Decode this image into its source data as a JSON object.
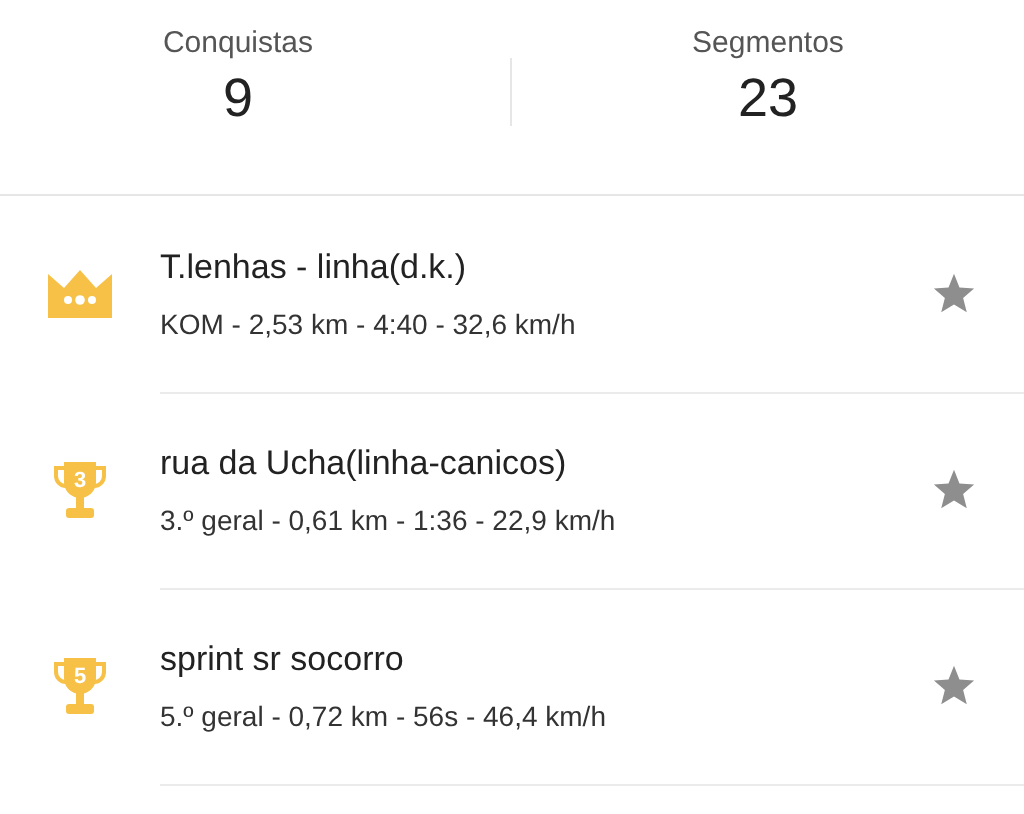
{
  "stats": [
    {
      "label": "Conquistas",
      "value": "9"
    },
    {
      "label": "Segmentos",
      "value": "23"
    }
  ],
  "achievements": [
    {
      "kind": "crown",
      "title": "T.lenhas - linha(d.k.)",
      "details": "KOM - 2,53 km - 4:40 - 32,6 km/h",
      "starred": false
    },
    {
      "kind": "trophy",
      "rank": "3",
      "title": "rua da Ucha(linha-canicos)",
      "details": "3.º geral - 0,61 km - 1:36 - 22,9 km/h",
      "starred": false
    },
    {
      "kind": "trophy",
      "rank": "5",
      "title": "sprint sr socorro",
      "details": "5.º geral - 0,72 km - 56s - 46,4 km/h",
      "starred": false
    }
  ]
}
